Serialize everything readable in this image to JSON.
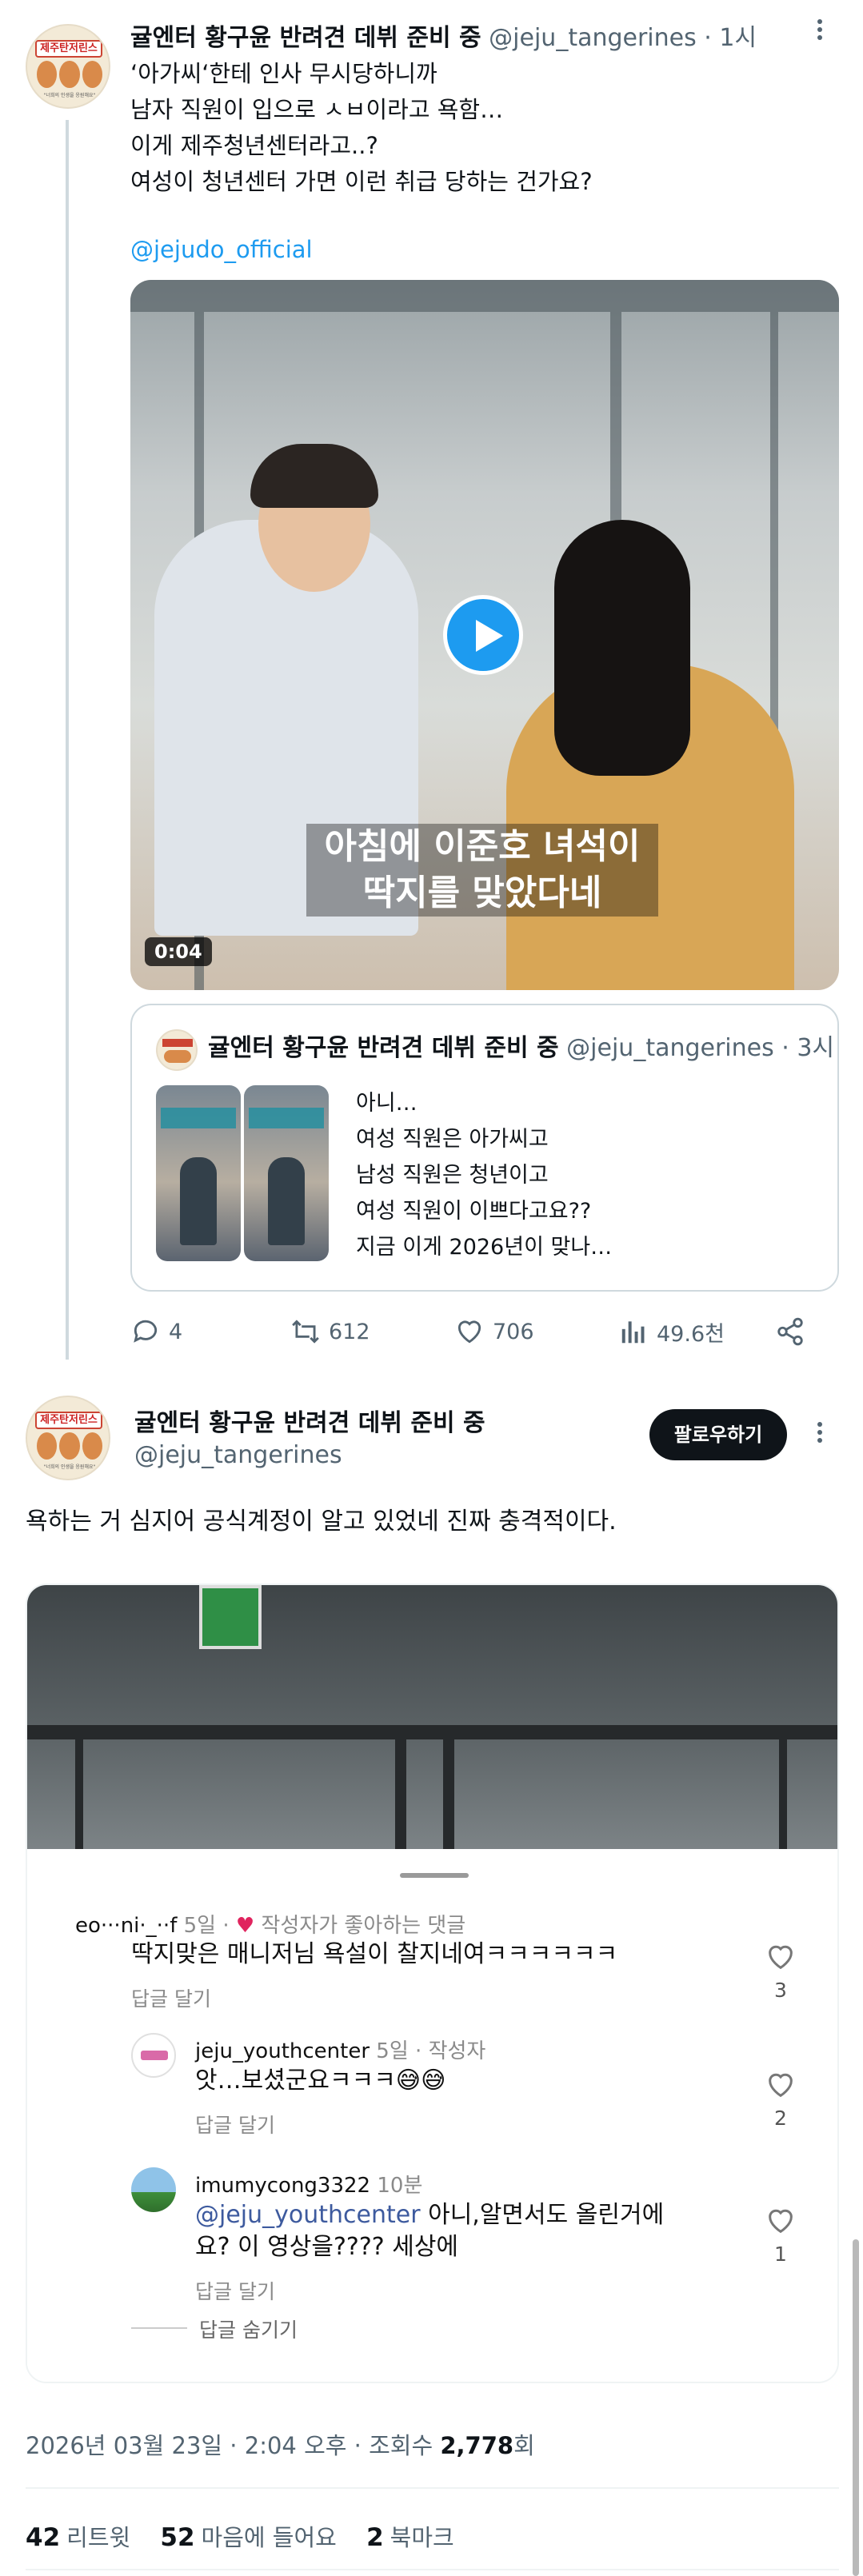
{
  "tweet1": {
    "display_name": "귤엔터 황구윤 반려견 데뷔 준비 중",
    "handle": "@jeju_tangerines",
    "time": "· 1시",
    "body_lines": "‘아가씨‘한테 인사 무시당하니까\n남자 직원이 입으로 ㅅㅂ이라고 욕함…\n이게 제주청년센터라고..?\n여성이 청년센터 가면 이런 취급 당하는 건가요?",
    "mention": "@jejudo_official",
    "video": {
      "caption_line1": "아침에 이준호 녀석이",
      "caption_line2": "딱지를 맞았다네",
      "duration": "0:04"
    },
    "quote": {
      "display_name": "귤엔터 황구윤 반려견 데뷔 준비 중",
      "handle": "@jeju_tangerines",
      "time": "· 3시",
      "text": "아니…\n여성 직원은 아가씨고\n남성 직원은 청년이고\n여성 직원이 이쁘다고요??\n지금 이게 2026년이 맞나…"
    },
    "actions": {
      "replies": "4",
      "retweets": "612",
      "likes": "706",
      "views": "49.6천"
    }
  },
  "avatar_sign": "제주탄저린스",
  "avatar_tagline": "\"너희의 인생을 응원해요\"",
  "tweet2": {
    "display_name": "귤엔터 황구윤 반려견 데뷔 준비 중",
    "handle": "@jeju_tangerines",
    "follow_label": "팔로우하기",
    "body": "욕하는 거 심지어 공식계정이 알고 있었네 진짜 충격적이다.",
    "comments": [
      {
        "user": "eo···ni·_··f",
        "time": "5일",
        "badge": "작성자가 좋아하는 댓글",
        "text": "딱지맞은 매니저님 욕설이 찰지네여ㅋㅋㅋㅋㅋㅋ",
        "reply_label": "답글 달기",
        "likes": "3"
      },
      {
        "user": "jeju_youthcenter",
        "time": "5일",
        "badge": "작성자",
        "text": "앗…보셨군요ㅋㅋㅋ😅😅",
        "reply_label": "답글 달기",
        "likes": "2"
      },
      {
        "user": "imumycong3322",
        "time": "10분",
        "mention": "@jeju_youthcenter",
        "text_rest": " 아니,알면서도 올린거에",
        "text_line2": "요? 이 영상을???? 세상에",
        "reply_label": "답글 달기",
        "hide_label": "답글 숨기기",
        "likes": "1"
      }
    ],
    "timestamp_prefix": "2026년 03월 23일 · 2:04 오후 · 조회수 ",
    "views_value": "2,778",
    "views_suffix": "회",
    "stats": {
      "retweets": "42",
      "retweets_label": "리트윗",
      "likes": "52",
      "likes_label": "마음에 들어요",
      "bookmarks": "2",
      "bookmarks_label": "북마크"
    }
  },
  "colors": {
    "accent": "#1d9bf0",
    "text_primary": "#0f1419",
    "text_secondary": "#536471",
    "like_red": "#e0245e"
  }
}
